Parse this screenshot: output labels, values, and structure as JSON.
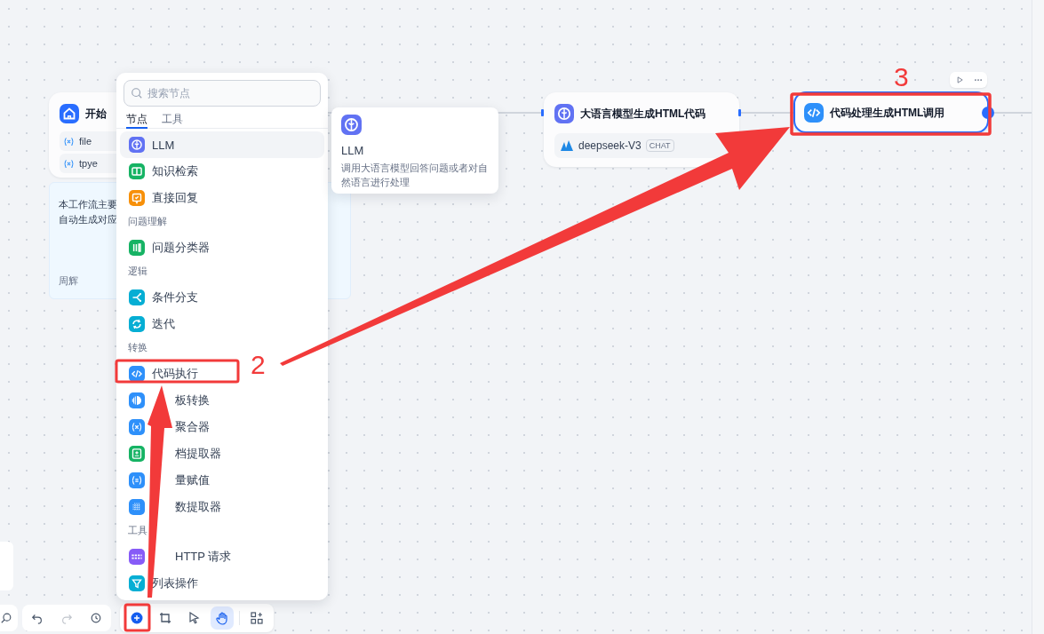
{
  "canvas": {
    "nodes": [
      {
        "kind": "start",
        "title": "开始",
        "variables": [
          "file",
          "tpye"
        ]
      },
      {
        "kind": "llm",
        "title": "大语言模型生成HTML代码",
        "model": "deepseek-V3",
        "badge": "CHAT"
      },
      {
        "kind": "code",
        "title": "代码处理生成HTML调用",
        "selected": true
      }
    ],
    "note": {
      "lines": [
        "本工作流主要",
        "自动生成对应"
      ],
      "author": "周辉"
    }
  },
  "node_menu": {
    "search": {
      "placeholder": "搜索节点"
    },
    "tabs": [
      {
        "label": "节点",
        "selected": true
      },
      {
        "label": "工具",
        "selected": false
      }
    ],
    "groups": [
      {
        "items": [
          {
            "label": "LLM",
            "kind": "brain",
            "color": "#6172f3",
            "hovered": true,
            "cut": false
          },
          {
            "label": "知识检索",
            "kind": "book",
            "color": "#16b364",
            "hovered": false,
            "cut": false
          },
          {
            "label": "直接回复",
            "kind": "reply",
            "color": "#f79009",
            "hovered": false,
            "cut": false
          }
        ]
      },
      {
        "label": "问题理解",
        "items": [
          {
            "label": "问题分类器",
            "kind": "bars",
            "color": "#16b364",
            "hovered": false,
            "cut": false
          }
        ]
      },
      {
        "label": "逻辑",
        "items": [
          {
            "label": "条件分支",
            "kind": "branch",
            "color": "#06aed4",
            "hovered": false,
            "cut": false
          },
          {
            "label": "迭代",
            "kind": "loop",
            "color": "#06aed4",
            "hovered": false,
            "cut": false
          }
        ]
      },
      {
        "label": "转换",
        "items": [
          {
            "label": "代码执行",
            "kind": "code",
            "color": "#2e90fa",
            "hovered": false,
            "cut": false
          },
          {
            "label": "板转换",
            "kind": "half",
            "color": "#2e90fa",
            "hovered": false,
            "cut": true
          },
          {
            "label": "聚合器",
            "kind": "var",
            "color": "#2e90fa",
            "hovered": false,
            "cut": true
          },
          {
            "label": "档提取器",
            "kind": "doc",
            "color": "#16b364",
            "hovered": false,
            "cut": true
          },
          {
            "label": "量赋值",
            "kind": "assign",
            "color": "#2e90fa",
            "hovered": false,
            "cut": true
          },
          {
            "label": "数提取器",
            "kind": "grid",
            "color": "#2e90fa",
            "hovered": false,
            "cut": true
          }
        ]
      },
      {
        "label": "工具",
        "items": [
          {
            "label": "HTTP 请求",
            "kind": "http",
            "color": "#875bf7",
            "hovered": false,
            "cut": true
          },
          {
            "label": "列表操作",
            "kind": "filter",
            "color": "#06aed4",
            "hovered": false,
            "cut": false
          }
        ]
      }
    ]
  },
  "tooltip": {
    "title": "LLM",
    "description": "调用大语言模型回答问题或者对自然语言进行处理"
  },
  "toolbar": {
    "tools": [
      {
        "kind": "add",
        "selected": false
      },
      {
        "kind": "crop",
        "selected": false
      },
      {
        "kind": "pointer",
        "selected": false
      },
      {
        "kind": "hand",
        "selected": true
      },
      {
        "kind": "apps",
        "selected": false
      }
    ]
  },
  "annotations": [
    {
      "label": "2"
    },
    {
      "label": "3"
    }
  ]
}
